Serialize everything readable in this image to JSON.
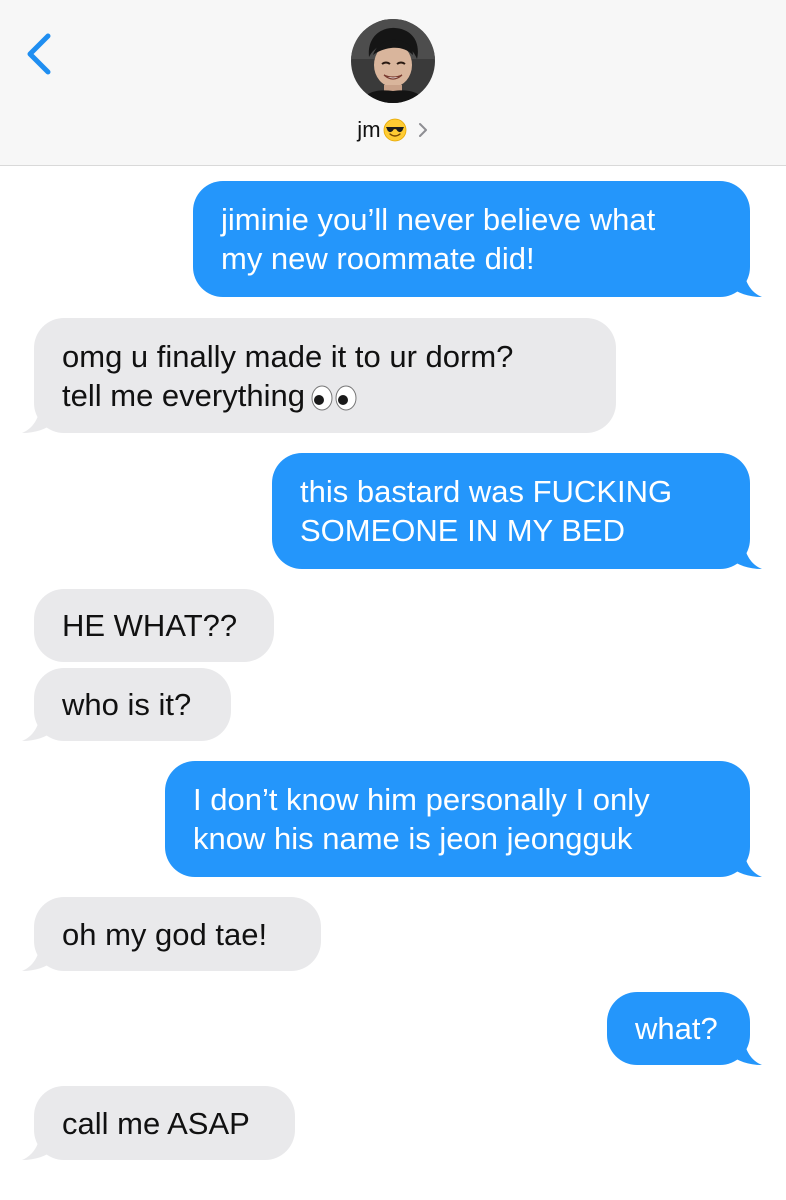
{
  "header": {
    "contact_name": "jm",
    "contact_emoji": "smiling-face-with-sunglasses",
    "back_icon": "chevron-left-icon",
    "details_icon": "chevron-right-icon"
  },
  "colors": {
    "sent_bubble": "#2496fb",
    "received_bubble": "#e9e9eb",
    "accent": "#1f8ef1",
    "header_bg": "#f7f7f7"
  },
  "messages": [
    {
      "direction": "sent",
      "lines": [
        "jiminie you’ll never believe what",
        "my new roommate did!"
      ]
    },
    {
      "direction": "received",
      "lines": [
        "omg u finally made it to ur dorm?",
        "tell me everything"
      ],
      "trailing_emoji": "eyes"
    },
    {
      "direction": "sent",
      "lines": [
        "this bastard was FUCKING",
        "SOMEONE IN MY BED"
      ]
    },
    {
      "direction": "received",
      "lines": [
        "HE WHAT??"
      ]
    },
    {
      "direction": "received",
      "lines": [
        "who is it?"
      ]
    },
    {
      "direction": "sent",
      "lines": [
        "I don’t know him personally I only",
        "know his name is jeon jeongguk"
      ]
    },
    {
      "direction": "received",
      "lines": [
        "oh my god tae!"
      ]
    },
    {
      "direction": "sent",
      "lines": [
        "what?"
      ]
    },
    {
      "direction": "received",
      "lines": [
        "call me ASAP"
      ]
    }
  ]
}
